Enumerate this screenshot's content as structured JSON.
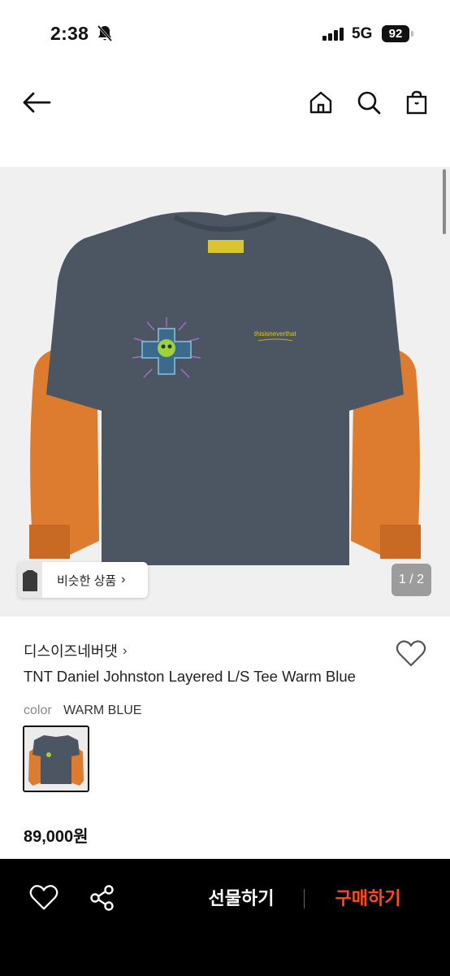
{
  "status_bar": {
    "time": "2:38",
    "network": "5G",
    "battery": "92"
  },
  "header": {
    "icons": [
      "back-arrow-icon",
      "home-icon",
      "search-icon",
      "shopping-bag-icon"
    ]
  },
  "gallery": {
    "similar_label": "비슷한 상품",
    "page_indicator": "1 / 2",
    "shirt_colors": {
      "body": "#4c5663",
      "sleeves": "#dd7b2e",
      "background": "#f0f0f0"
    }
  },
  "product": {
    "brand": "디스이즈네버댓",
    "name": "TNT Daniel Johnston Layered L/S Tee Warm Blue",
    "color_key": "color",
    "color_value": "WARM BLUE",
    "price": "89,000원"
  },
  "bottom_bar": {
    "gift_label": "선물하기",
    "buy_label": "구매하기",
    "buy_color": "#ff4a1c"
  }
}
